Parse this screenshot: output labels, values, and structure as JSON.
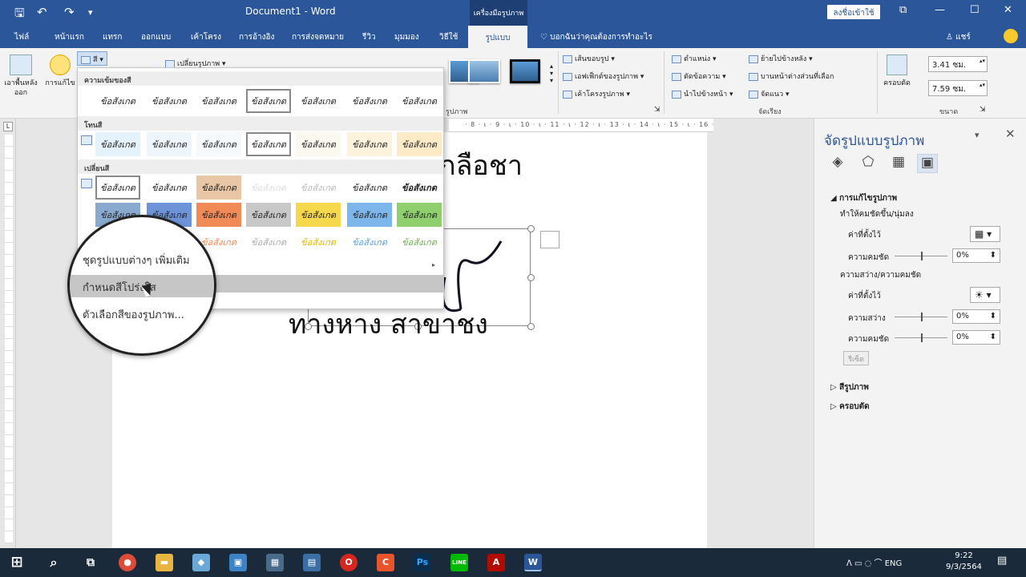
{
  "titlebar": {
    "doc_title": "Document1 - Word",
    "tools_context": "เครื่องมือรูปภาพ",
    "signin": "ลงชื่อเข้าใช้",
    "save_glyph": "🖫",
    "undo_glyph": "↶",
    "redo_glyph": "↷",
    "qa_more_glyph": "▾",
    "restore_glyph": "⧉",
    "minimize_glyph": "—",
    "maximize_glyph": "☐",
    "close_glyph": "✕"
  },
  "tabs": [
    "ไฟล์",
    "หน้าแรก",
    "แทรก",
    "ออกแบบ",
    "เค้าโครง",
    "การอ้างอิง",
    "การส่งจดหมาย",
    "รีวิว",
    "มุมมอง",
    "วิธีใช้"
  ],
  "active_tab": "รูปแบบ",
  "tellme": "บอกฉันว่าคุณต้องการทำอะไร",
  "tellme_glyph": "♡",
  "user": "♙ แชร์",
  "ribbon": {
    "remove_bg": "เอาพื้นหลังออก",
    "corrections": "การแก้ไข",
    "color_btn": "สี ▾",
    "change_picture": "เปลี่ยนรูปภาพ ▾",
    "picture_border": "เส้นขอบรูป ▾",
    "picture_effects": "เอฟเฟ็กต์ของรูปภาพ ▾",
    "picture_layout": "เค้าโครงรูปภาพ ▾",
    "styles_label": "รูปภาพ",
    "position": "ตำแหน่ง ▾",
    "wrap_text": "ตัดข้อความ ▾",
    "bring_forward": "นำไปข้างหน้า ▾",
    "send_backward": "ย้ายไปข้างหลัง ▾",
    "selection_pane": "บานหน้าต่างส่วนที่เลือก",
    "align": "จัดแนว ▾",
    "arrange_label": "จัดเรียง",
    "crop": "ครอบตัด",
    "height": "3.41 ซม.",
    "width": "7.59 ซม.",
    "size_label": "ขนาด",
    "spin_glyph": "▴▾",
    "launcher_glyph": "⇲"
  },
  "ruler": {
    "ticks": "· 8 · ι · 9 · ι · 10 · ι · 11 · ι · 12 · ι · 13 · ι · 14 · ι · 15 · ι · 16 · ι · 17 · ι · 18",
    "corner": "L"
  },
  "document": {
    "line1": "กลือชา",
    "line2": "ทางหาง สาขาชง"
  },
  "color_menu": {
    "sec_saturation": "ความเข้มของสี",
    "sec_tone": "โทนสี",
    "sec_recolor": "เปลี่ยนสี",
    "sig": "ข้อสังเกต",
    "more_variations": "ชุดรูปแบบต่างๆ เพิ่มเติม",
    "set_transparent": "กำหนดสีโปร่งใส",
    "color_options": "ตัวเลือกสีของรูปภาพ...",
    "more_arrow": "▸"
  },
  "magnifier": {
    "more_variations": "ชุดรูปแบบต่างๆ เพิ่มเติม",
    "set_transparent": "กำหนดสีโปร่งใส",
    "color_options": "ตัวเลือกสีของรูปภาพ..."
  },
  "taskpane": {
    "title": "จัดรูปแบบรูปภาพ",
    "dd_glyph": "▾",
    "close_glyph": "✕",
    "tab_glyphs": [
      "◈",
      "⬠",
      "▦",
      "▣"
    ],
    "section_corrections": "◢  การแก้ไขรูปภาพ",
    "sharpen_soften": "ทำให้คมชัดขึ้น/นุ่มลง",
    "presets1": "ค่าที่ตั้งไว้",
    "sharpness": "ความคมชัด",
    "sharpness_val": "0%",
    "bright_contrast": "ความสว่าง/ความคมชัด",
    "presets2": "ค่าที่ตั้งไว้",
    "brightness": "ความสว่าง",
    "brightness_val": "0%",
    "contrast": "ความคมชัด",
    "contrast_val": "0%",
    "reset": "รีเซ็ต",
    "section_color": "▷  สีรูปภาพ",
    "section_crop": "▷  ครอบตัด",
    "dd1_glyph": "▦ ▾",
    "dd2_glyph": "☀ ▾",
    "spin_glyph": "⬍"
  },
  "taskbar": {
    "start_glyph": "⊞",
    "search_glyph": "⌕",
    "taskview_glyph": "⧉",
    "apps": [
      "●",
      "▬",
      "◆",
      "▣",
      "▦",
      "▤",
      "O",
      "C",
      "Ps",
      "LINE",
      "A",
      "W"
    ],
    "tray": "ᐱ  ▭  ◌  ⌒  ENG",
    "time": "9:22",
    "date": "9/3/2564",
    "notif_glyph": "▤"
  },
  "colors": {
    "accent": "#2b579a",
    "taskbar": "#1b2a3a"
  }
}
